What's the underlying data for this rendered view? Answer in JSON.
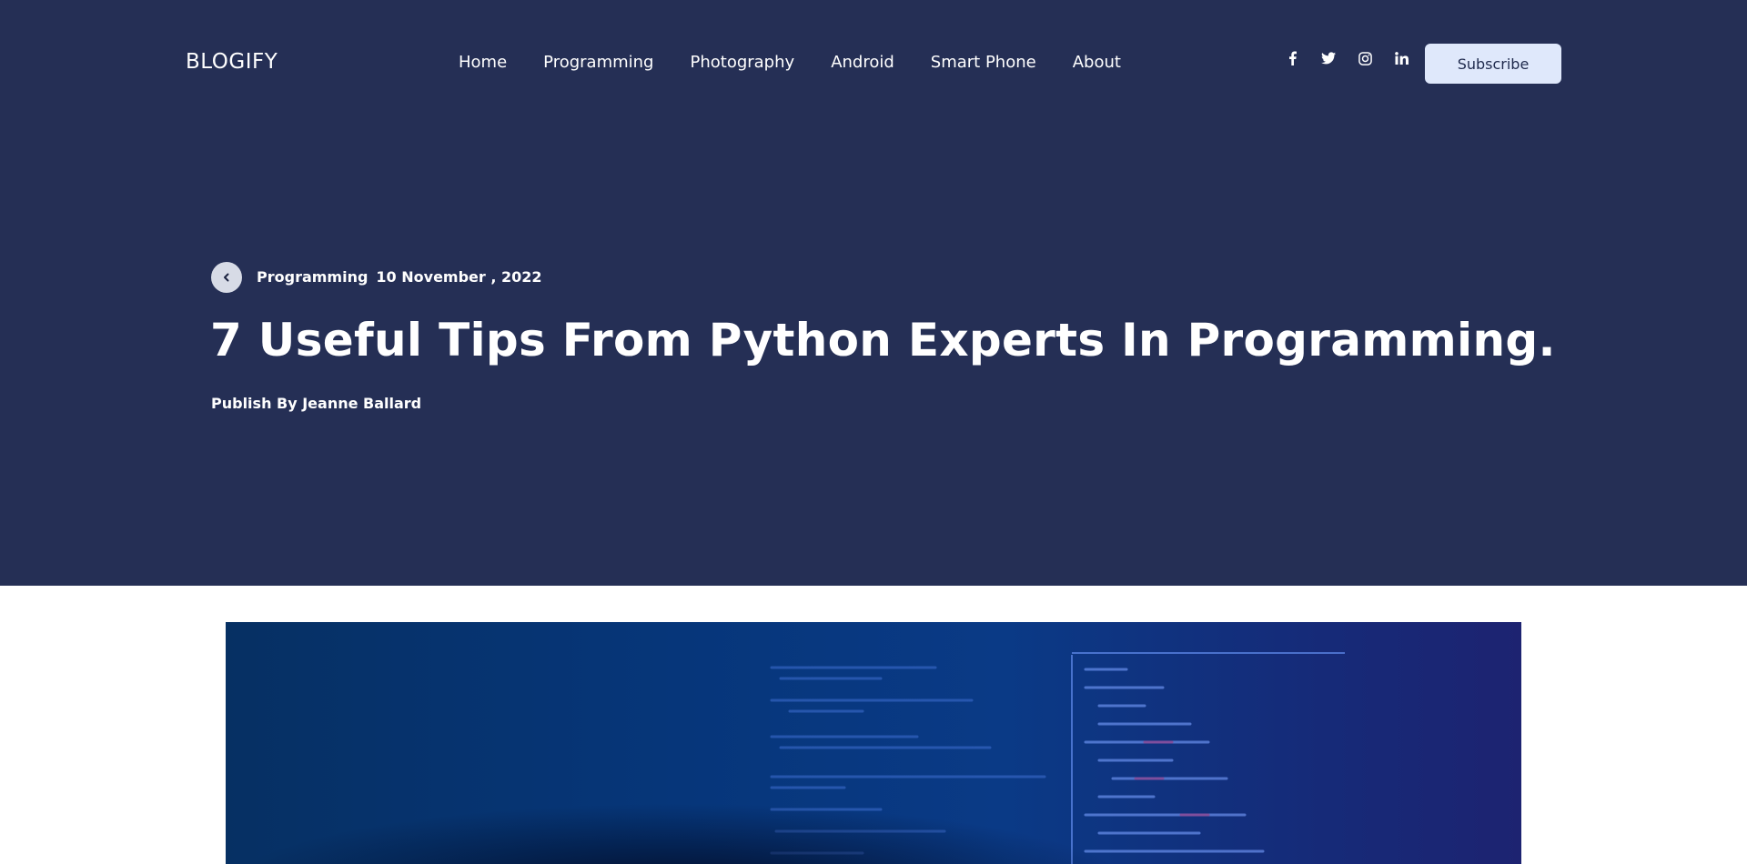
{
  "header": {
    "logo": "BLOGIFY",
    "nav": [
      "Home",
      "Programming",
      "Photography",
      "Android",
      "Smart Phone",
      "About"
    ],
    "social_icons": [
      "facebook-icon",
      "twitter-icon",
      "instagram-icon",
      "linkedin-icon"
    ],
    "subscribe_label": "Subscribe"
  },
  "post": {
    "category": "Programming",
    "date": "10 November , 2022",
    "title": "7 Useful Tips From Python Experts In Programming.",
    "author_line": "Publish By Jeanne Ballard"
  },
  "colors": {
    "hero_bg": "#252f55",
    "subscribe_bg": "#dfe8fb",
    "text_light": "#ffffff"
  }
}
